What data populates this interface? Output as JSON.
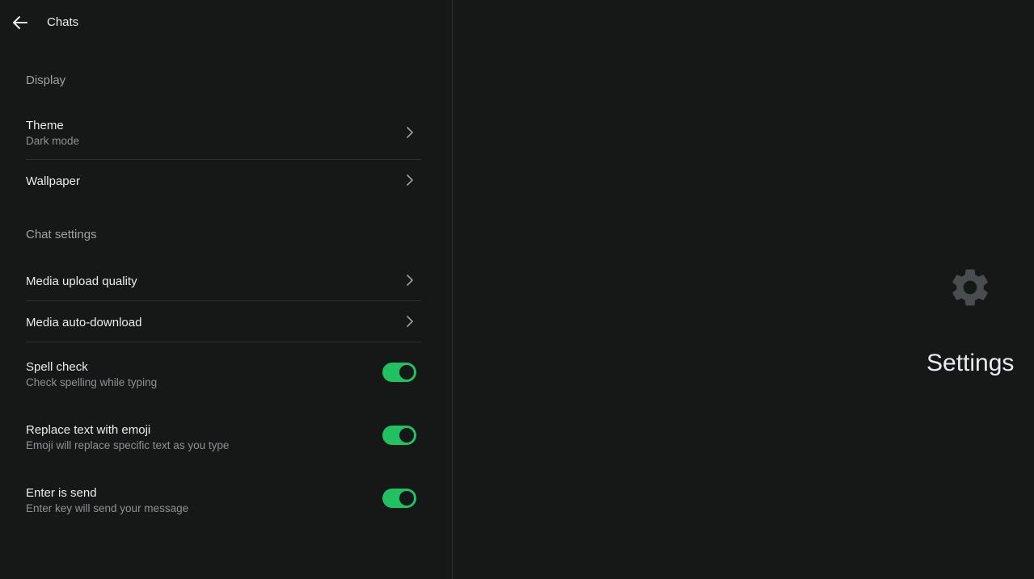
{
  "header": {
    "title": "Chats",
    "back_icon": "arrow-left-icon"
  },
  "display": {
    "section_title": "Display",
    "theme": {
      "label": "Theme",
      "value": "Dark mode"
    },
    "wallpaper": {
      "label": "Wallpaper"
    }
  },
  "chat_settings": {
    "section_title": "Chat settings",
    "media_upload_quality": {
      "label": "Media upload quality"
    },
    "media_auto_download": {
      "label": "Media auto-download"
    },
    "spell_check": {
      "label": "Spell check",
      "sub": "Check spelling while typing",
      "enabled": true
    },
    "replace_emoji": {
      "label": "Replace text with emoji",
      "sub": "Emoji will replace specific text as you type",
      "enabled": true
    },
    "enter_send": {
      "label": "Enter is send",
      "sub": "Enter key will send your message",
      "enabled": true
    }
  },
  "right_panel": {
    "title": "Settings",
    "icon": "gear-icon"
  },
  "colors": {
    "background": "#161717",
    "accent": "#21c063",
    "text_primary": "#e9edef",
    "text_secondary": "#8d9295"
  }
}
